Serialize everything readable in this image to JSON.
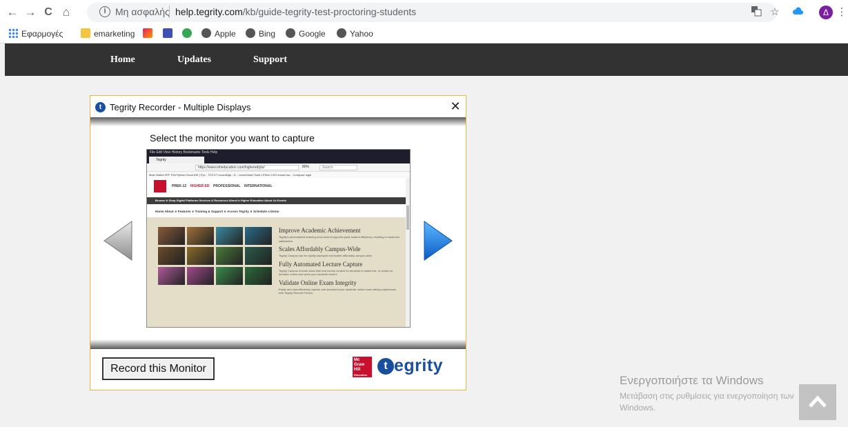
{
  "browser": {
    "nav": {
      "back": "←",
      "forward": "→",
      "reload": "C",
      "home": "⌂"
    },
    "address": {
      "security_label": "Μη ασφαλής",
      "url_domain": "help.tegrity.com",
      "url_path": "/kb/guide-tegrity-test-proctoring-students"
    },
    "profile_initial": "Δ",
    "bookmarks": [
      {
        "label": "Εφαρμογές",
        "icon": "apps-icon",
        "color": "#4285f4"
      },
      {
        "label": "emarketing",
        "icon": "folder-icon",
        "color": "#f4c542"
      },
      {
        "label": "",
        "icon": "rss-icon",
        "color": "#e91e63"
      },
      {
        "label": "",
        "icon": "shop-icon",
        "color": "#3f51b5"
      },
      {
        "label": "",
        "icon": "xd-icon",
        "color": "#34a853"
      },
      {
        "label": "Apple",
        "icon": "apple-icon",
        "color": "#555555"
      },
      {
        "label": "Bing",
        "icon": "globe-icon",
        "color": "#555555"
      },
      {
        "label": "Google",
        "icon": "globe-icon",
        "color": "#555555"
      },
      {
        "label": "Yahoo",
        "icon": "globe-icon",
        "color": "#555555"
      }
    ]
  },
  "site_nav": {
    "items": [
      "Home",
      "Updates",
      "Support"
    ]
  },
  "dialog": {
    "title": "Tegrity Recorder - Multiple Displays",
    "close": "✕",
    "prompt": "Select the monitor you want to capture",
    "record_button": "Record this Monitor",
    "brand": {
      "mgh_line1": "Mc",
      "mgh_line2": "Graw",
      "mgh_line3": "Hill",
      "mgh_line4": "Education",
      "tegrity_rest": "egrity",
      "tegrity_t": "t"
    },
    "colors": {
      "arrow_blue": "#1f77d4",
      "arrow_gray": "#b5b5b5",
      "frame": "#e9b838"
    }
  },
  "preview": {
    "menu": "File  Edit  View  History  Bookmarks  Tools  Help",
    "tab": "Tegrity",
    "url": "https://www.mheducation.com/highered/ptx/",
    "zoom": "80%",
    "search": "Search",
    "bookmarks": "Most Visited  SFF  STA  Python Cloud IDE | Pyt...  TCS KT recordings - D...  LearnSmart Tools  LSTech CXG known iss...  Compose login",
    "header": {
      "prek": "PREK-12",
      "highered": "HIGHER ED",
      "professional": "PROFESSIONAL",
      "international": "INTERNATIONAL"
    },
    "nav1": "Browse & Shop   Digital Platforms   Services & Resources   About in Higher Education   About Us   Events",
    "nav2": "Home    About ∨    Features ∨    Training & Support ∨    Access Tegrity ∨    Schedule a Demo",
    "sections": [
      {
        "heading": "Improve Academic Achievement",
        "body": "Tegrity's personalized learning environment supports great student efficiency, resulting in maximum satisfaction."
      },
      {
        "heading": "Scales Affordably Campus-Wide",
        "body": "Tegrity Campus can be rapidly deployed and scales affordably campus-wide."
      },
      {
        "heading": "Fully Automated Lecture Capture",
        "body": "Tegrity Campus records class time and course content for students to watch live, or review on demand, where and when your students need it."
      },
      {
        "heading": "Validate Online Exam Integrity",
        "body": "Easily and cost-effectively capture and document your students' online exam-taking experiences with Tegrity Remote Proctor."
      }
    ],
    "tile_colors": [
      "#8a5a3a",
      "#a0703a",
      "#3a8aa0",
      "#2a6a8a",
      "#6a4a2a",
      "#8a6a2a",
      "#4a7a3a",
      "#2a5a4a",
      "#b05a9a",
      "#a04a8a",
      "#3a8a4a",
      "#2a6a3a"
    ]
  },
  "watermark": {
    "title": "Ενεργοποιήστε τα Windows",
    "subtitle": "Μετάβαση στις ρυθμίσεις για ενεργοποίηση των Windows."
  }
}
